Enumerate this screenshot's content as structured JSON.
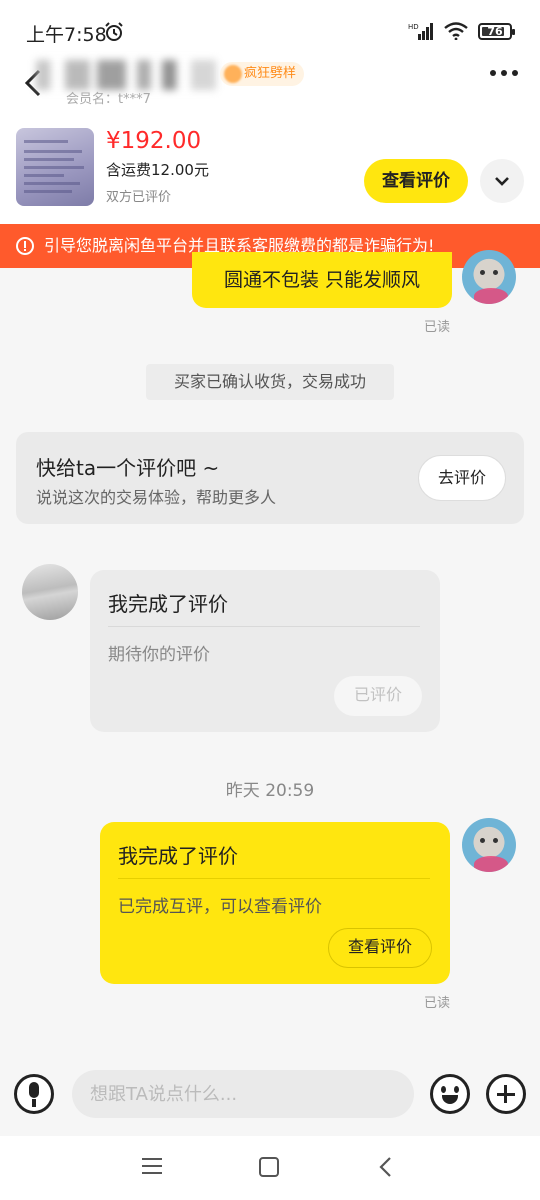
{
  "status_bar": {
    "time": "上午7:58",
    "battery": "76"
  },
  "header": {
    "badge": "疯狂劈样",
    "member_label": "会员名：t***7"
  },
  "product": {
    "price": "¥192.00",
    "shipping": "含运费12.00元",
    "status": "双方已评价",
    "view_review_label": "查看评价"
  },
  "warning": {
    "text": "引导您脱离闲鱼平台并且联系客服缴费的都是诈骗行为!"
  },
  "chat": {
    "message_1": "圆通不包装 只能发顺风",
    "read_1": "已读",
    "system_notice": "买家已确认收货，交易成功",
    "review_prompt": {
      "title": "快给ta一个评价吧 ~",
      "subtitle": "说说这次的交易体验，帮助更多人",
      "button": "去评价"
    },
    "seller_card": {
      "title": "我完成了评价",
      "subtitle": "期待你的评价",
      "button": "已评价"
    },
    "timestamp": "昨天 20:59",
    "my_card": {
      "title": "我完成了评价",
      "subtitle": "已完成互评，可以查看评价",
      "button": "查看评价"
    },
    "read_2": "已读"
  },
  "input": {
    "placeholder": "想跟TA说点什么..."
  },
  "colors": {
    "accent_yellow": "#ffe60f",
    "warning_bg": "#ff5a2c",
    "price_red": "#ff2a2a"
  },
  "icons": [
    "alarm-icon",
    "signal-icon",
    "wifi-icon",
    "battery-icon",
    "back-icon",
    "more-icon",
    "chevron-down-icon",
    "warning-icon",
    "microphone-icon",
    "emoji-icon",
    "plus-icon",
    "nav-menu-icon",
    "nav-home-icon",
    "nav-back-icon"
  ]
}
